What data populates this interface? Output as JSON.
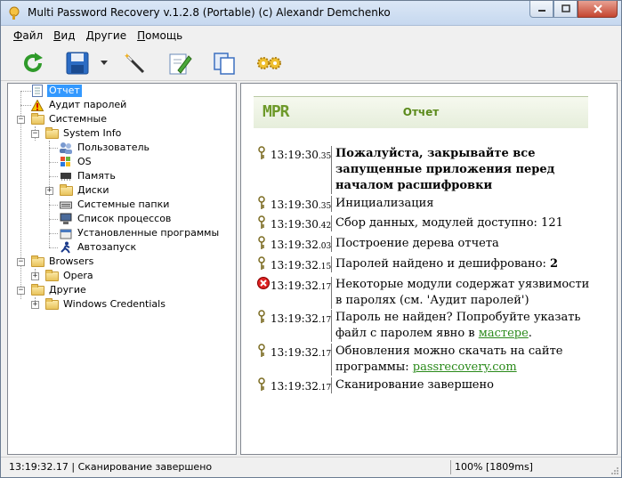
{
  "window": {
    "title": "Multi Password Recovery v.1.2.8 (Portable) (c) Alexandr Demchenko"
  },
  "menu": [
    {
      "accel": "Ф",
      "rest": "айл"
    },
    {
      "accel": "В",
      "rest": "ид"
    },
    {
      "accel": "Д",
      "rest": "ругие"
    },
    {
      "accel": "П",
      "rest": "омощь"
    }
  ],
  "toolbar": {
    "icons": [
      "refresh-icon",
      "save-icon",
      "dropdown-arrow-icon",
      "magic-wand-icon",
      "edit-icon",
      "copy-icon",
      "gears-icon"
    ]
  },
  "tree": {
    "report": "Отчет",
    "audit": "Аудит паролей",
    "system": "Системные",
    "system_info": "System Info",
    "user": "Пользователь",
    "os": "OS",
    "memory": "Память",
    "disks": "Диски",
    "system_folders": "Системные папки",
    "processes": "Список процессов",
    "installed": "Установленные программы",
    "autorun": "Автозапуск",
    "browsers": "Browsers",
    "opera": "Opera",
    "others": "Другие",
    "win_credentials": "Windows Credentials"
  },
  "report": {
    "logo": "MPR",
    "title": "Отчет",
    "entries": [
      {
        "time": "13:19:30",
        "ms": ".35",
        "text": "Пожалуйста, закрывайте все запущенные приложения перед началом расшифровки"
      },
      {
        "time": "13:19:30",
        "ms": ".35",
        "text": "Инициализация"
      },
      {
        "time": "13:19:30",
        "ms": ".42",
        "text": "Сбор данных, модулей доступно: 121"
      },
      {
        "time": "13:19:32",
        "ms": ".03",
        "text": "Построение дерева отчета"
      },
      {
        "time": "13:19:32",
        "ms": ".15",
        "text": "Паролей найдено и дешифровано: ",
        "strong": "2"
      },
      {
        "time": "13:19:32",
        "ms": ".17",
        "text": "Некоторые модули содержат уязвимости в паролях (см. 'Аудит паролей')"
      },
      {
        "time": "13:19:32",
        "ms": ".17",
        "text": "Пароль не найден? Попробуйте указать файл с паролем явно в ",
        "link": "мастере",
        "tail": "."
      },
      {
        "time": "13:19:32",
        "ms": ".17",
        "text": "Обновления можно скачать на сайте программы: ",
        "link": "passrecovery.com"
      },
      {
        "time": "13:19:32",
        "ms": ".17",
        "text": "Сканирование завершено"
      }
    ]
  },
  "status": {
    "left": "13:19:32.17 | Сканирование завершено",
    "right": "100% [1809ms]"
  },
  "colors": {
    "accent": "#5b8a1b",
    "link": "#2a8a1a",
    "selection": "#3399ff"
  }
}
